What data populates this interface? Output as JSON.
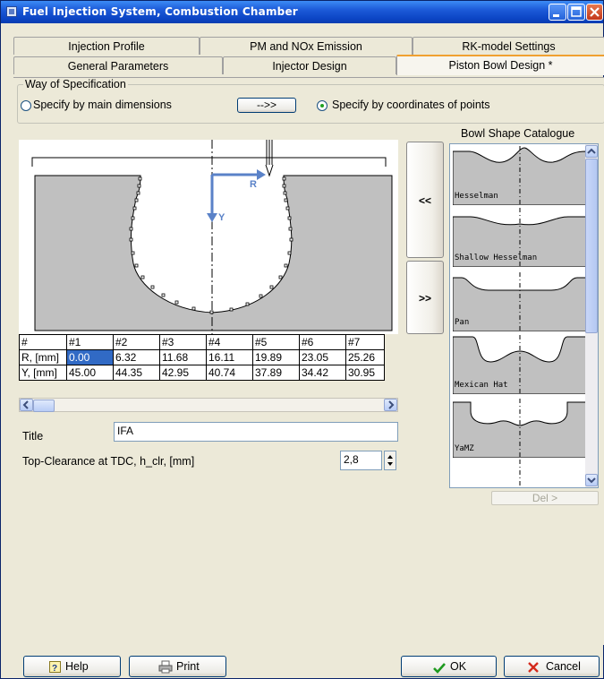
{
  "window": {
    "title": "Fuel Injection System, Combustion Chamber"
  },
  "tabs_top": [
    "Injection Profile",
    "PM and NOx Emission",
    "RK-model Settings"
  ],
  "tabs_bottom": [
    "General Parameters",
    "Injector Design",
    "Piston Bowl Design  *"
  ],
  "specification": {
    "group_label": "Way of Specification",
    "option_main": "Specify by main dimensions",
    "arrow_button": "-->>",
    "option_coords": "Specify by coordinates of points",
    "selected": "coords"
  },
  "catalogue": {
    "title": "Bowl Shape Catalogue",
    "items": [
      "Hesselman",
      "Shallow Hesselman",
      "Pan",
      "Mexican Hat",
      "YaMZ"
    ],
    "del_button": "Del >"
  },
  "drawing": {
    "axis_r": "R",
    "axis_y": "Y"
  },
  "move_left_button": "<<",
  "move_right_button": ">>",
  "points_table": {
    "headers": [
      "#",
      "#1",
      "#2",
      "#3",
      "#4",
      "#5",
      "#6",
      "#7"
    ],
    "rows": [
      [
        "R, [mm]",
        "0.00",
        "6.32",
        "11.68",
        "16.11",
        "19.89",
        "23.05",
        "25.26"
      ],
      [
        "Y, [mm]",
        "45.00",
        "44.35",
        "42.95",
        "40.74",
        "37.89",
        "34.42",
        "30.95"
      ]
    ]
  },
  "fields": {
    "title_label": "Title",
    "title_value": "IFA",
    "clearance_label": "Top-Clearance at TDC, h_clr, [mm]",
    "clearance_value": "2,8"
  },
  "buttons": {
    "help": "Help",
    "print": "Print",
    "ok": "OK",
    "cancel": "Cancel"
  },
  "colors": {
    "title_bar": "#0b44c4",
    "bowl_fill": "#c0c0c0",
    "axis_arrow": "#5a82c8",
    "active_tab_accent": "#f0a030"
  }
}
